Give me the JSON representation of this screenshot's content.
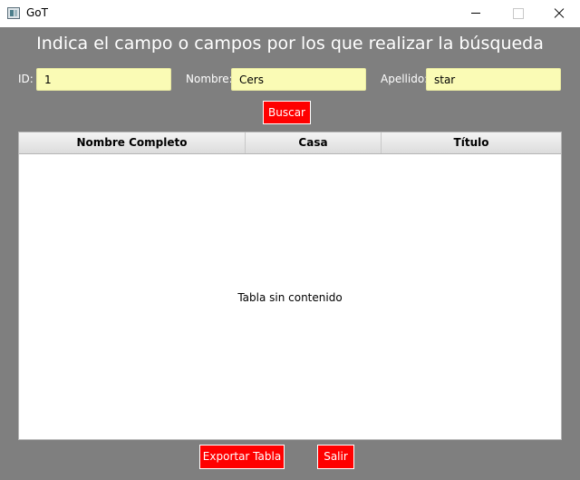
{
  "window": {
    "title": "GoT",
    "icon": "app-icon"
  },
  "heading": "Indica el campo o campos por los que realizar la búsqueda",
  "search": {
    "id_label": "ID:",
    "id_value": "1",
    "nombre_label": "Nombre:",
    "nombre_value": "Cers",
    "apellido_label": "Apellido:",
    "apellido_value": "star",
    "buscar_label": "Buscar"
  },
  "table": {
    "columns": [
      "Nombre Completo",
      "Casa",
      "Título"
    ],
    "rows": [],
    "empty_text": "Tabla sin contenido"
  },
  "footer": {
    "exportar_label": "Exportar Tabla",
    "salir_label": "Salir"
  },
  "colors": {
    "background": "#7f7f7f",
    "button": "#ff0000",
    "input": "#fafbb5"
  }
}
